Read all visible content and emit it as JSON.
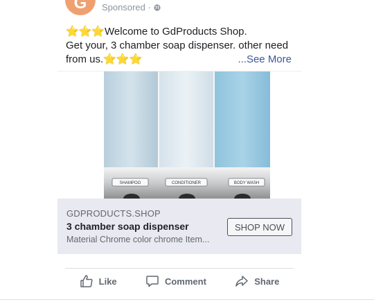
{
  "header": {
    "avatar_letter": "G",
    "sponsored_label": "Sponsored ·"
  },
  "caption": {
    "line1_stars": "⭐⭐⭐",
    "line1_text": "Welcome to GdProducts Shop.",
    "line2_text": "Get your, 3 chamber soap dispenser. other need",
    "line3_text": "from us.",
    "line3_stars": "⭐⭐⭐",
    "see_more": "...See More"
  },
  "product_image": {
    "labels": [
      "SHAMPOO",
      "CONDITIONER",
      "BODY WASH"
    ]
  },
  "link_preview": {
    "domain": "GDPRODUCTS.SHOP",
    "title": "3 chamber soap dispenser",
    "description": "Material Chrome color chrome Item...",
    "cta_label": "SHOP NOW"
  },
  "actions": {
    "like": "Like",
    "comment": "Comment",
    "share": "Share"
  },
  "icons": {
    "privacy": "globe-icon",
    "like": "thumbs-up-icon",
    "comment": "comment-icon",
    "share": "share-arrow-icon"
  },
  "colors": {
    "link_box_bg": "#e9e9f2",
    "see_more": "#3b5998",
    "avatar": "#f0a070"
  }
}
